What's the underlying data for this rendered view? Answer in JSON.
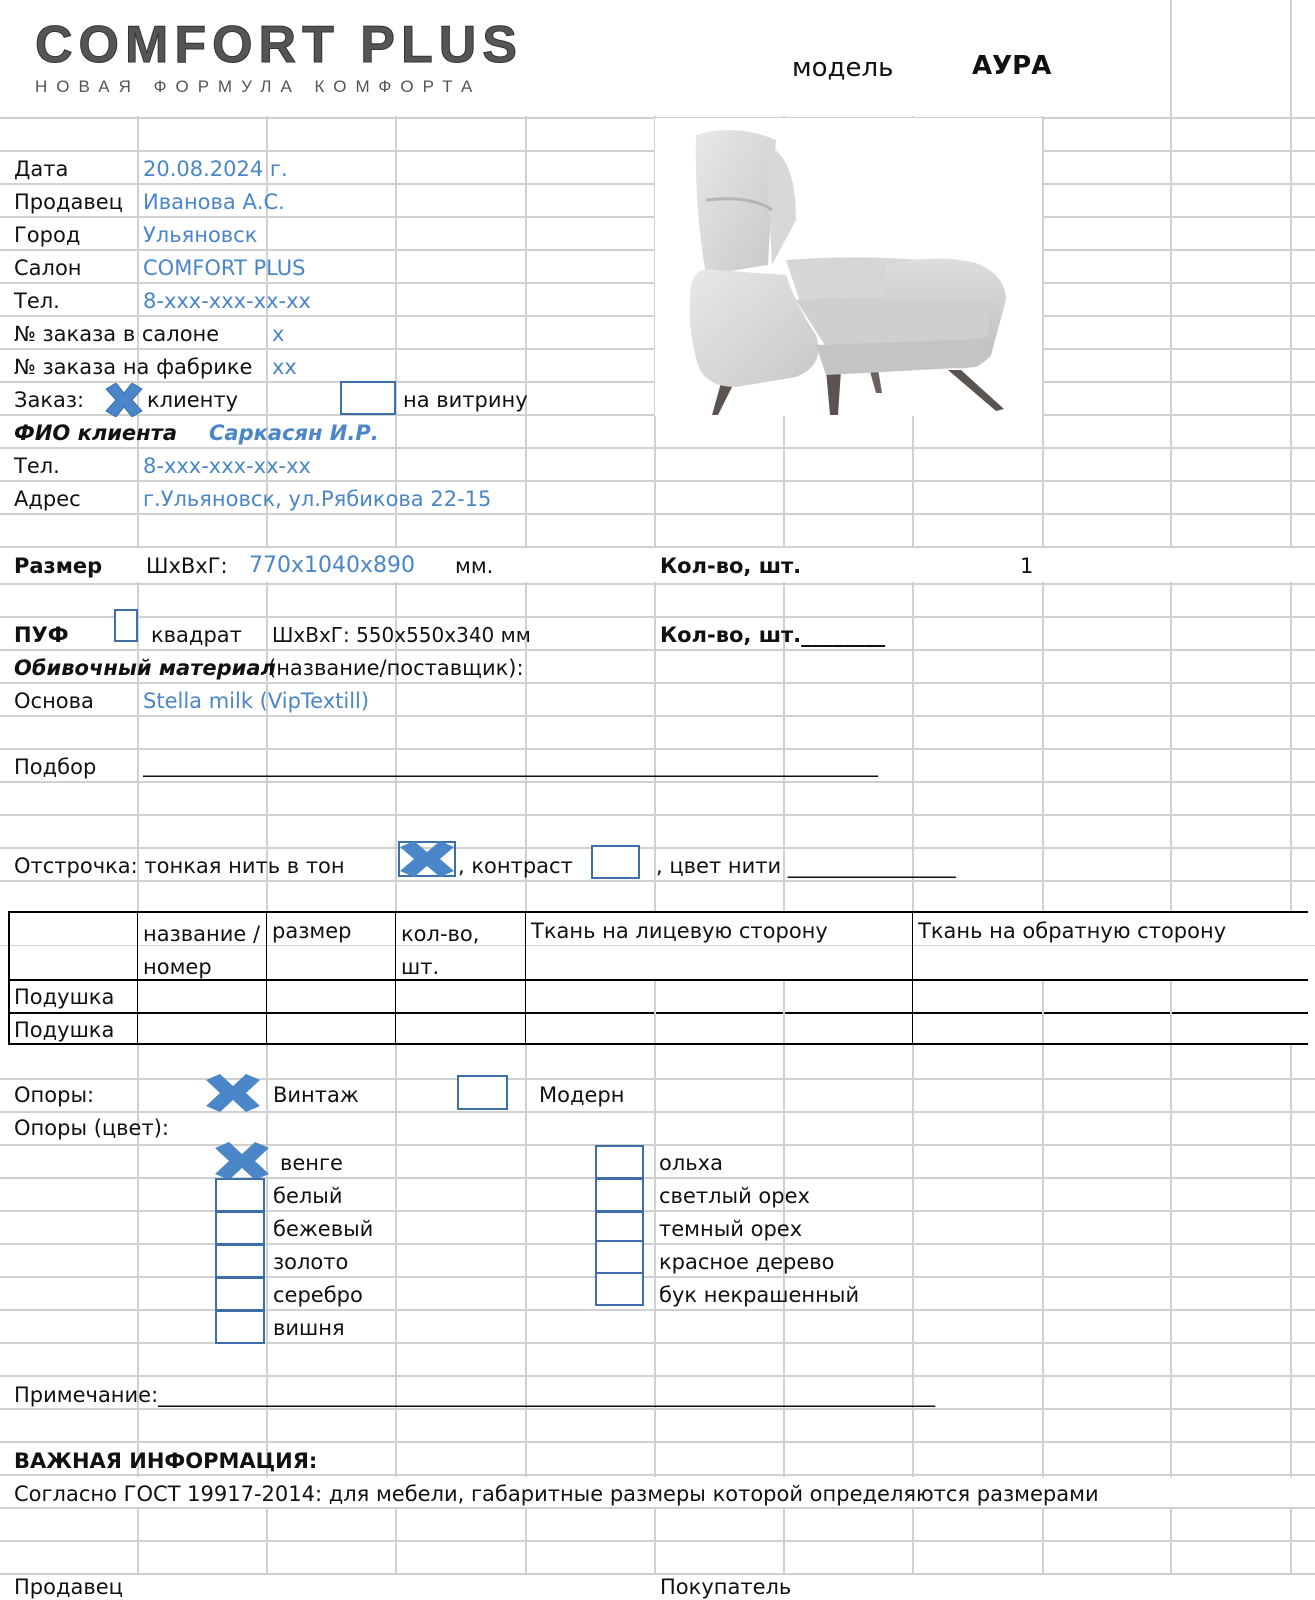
{
  "header": {
    "logo_text": "COMFORT PLUS",
    "logo_tagline": "НОВАЯ ФОРМУЛА КОМФОРТА",
    "model_label": "модель",
    "model_value": "АУРА"
  },
  "fields": [
    {
      "label": "Дата",
      "value": "20.08.2024 г."
    },
    {
      "label": "Продавец",
      "value": "Иванова А.С."
    },
    {
      "label": "Город",
      "value": "Ульяновск"
    },
    {
      "label": "Салон",
      "value": "COMFORT PLUS"
    },
    {
      "label": "Тел.",
      "value": "8-xxx-xxx-xx-xx"
    },
    {
      "label": "№ заказа в салоне",
      "value": "x"
    },
    {
      "label": "№ заказа на фабрике",
      "value": "xx"
    }
  ],
  "order_type": {
    "label": "Заказ:",
    "option1": "клиенту",
    "option1_checked": true,
    "option2": "на витрину",
    "option2_checked": false
  },
  "client": {
    "name_label": "ФИО клиента",
    "name_value": "Саркасян И.Р.",
    "phone_label": "Тел.",
    "phone_value": "8-xxx-xxx-xx-xx",
    "address_label": "Адрес",
    "address_value": "г.Ульяновск, ул.Рябикова 22-15"
  },
  "size": {
    "label": "Размер",
    "dims_label": "ШхВхГ:",
    "dims_value": "770x1040x890",
    "unit": "мм.",
    "qty_label": "Кол-во, шт.",
    "qty_value": "1"
  },
  "pouf": {
    "label": "ПУФ",
    "checked": false,
    "shape": "квадрат",
    "dims": "ШхВхГ: 550х550х340 мм",
    "qty_label": "Кол-во, шт.________"
  },
  "material": {
    "title": "Обивочный материал",
    "subtitle": "(название/поставщик):",
    "base_label": "Основа",
    "base_value": "Stella milk (VipTextill)",
    "match_label": "Подбор",
    "match_value": "______________________________________________________________________"
  },
  "stitching": {
    "label": "Отстрочка:  тонкая нить в тон",
    "tone_checked": true,
    "contrast_label": ", контраст",
    "contrast_checked": false,
    "color_label": ", цвет нити ________________"
  },
  "cushions": {
    "headers": [
      "",
      "название /номер",
      "размер",
      "кол-во, шт.",
      "Ткань на лицевую сторону",
      "Ткань на обратную сторону"
    ],
    "rows": [
      [
        "Подушка",
        "",
        "",
        "",
        "",
        ""
      ],
      [
        "Подушка",
        "",
        "",
        "",
        "",
        ""
      ]
    ]
  },
  "legs": {
    "label": "Опоры:",
    "vintage": "Винтаж",
    "vintage_checked": true,
    "modern": "Модерн",
    "modern_checked": false,
    "color_label": "Опоры (цвет):",
    "colors_left": [
      {
        "name": "венге",
        "checked": true
      },
      {
        "name": " белый",
        "checked": false
      },
      {
        "name": "бежевый",
        "checked": false
      },
      {
        "name": "золото",
        "checked": false
      },
      {
        "name": "серебро",
        "checked": false
      },
      {
        "name": "вишня",
        "checked": false
      }
    ],
    "colors_right": [
      {
        "name": "ольха",
        "checked": false
      },
      {
        "name": "светлый орех",
        "checked": false
      },
      {
        "name": "темный орех",
        "checked": false
      },
      {
        "name": "красное дерево",
        "checked": false
      },
      {
        "name": "бук некрашенный",
        "checked": false
      }
    ]
  },
  "note": {
    "label": "Примечание:__________________________________________________________________________"
  },
  "important": {
    "title": "ВАЖНАЯ  ИНФОРМАЦИЯ:",
    "text": "Согласно ГОСТ 19917-2014: для мебели, габаритные размеры которой определяются размерами"
  },
  "signatures": {
    "seller": "Продавец",
    "buyer": "Покупатель"
  }
}
